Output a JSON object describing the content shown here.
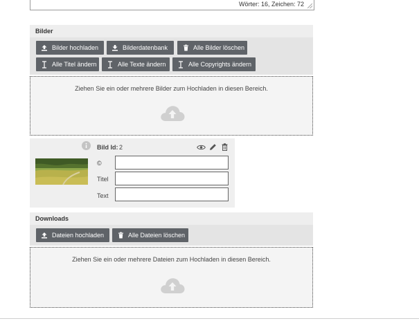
{
  "editor": {
    "wordcount": "Wörter: 16, Zeichen: 72"
  },
  "images": {
    "section_title": "Bilder",
    "buttons": {
      "upload": "Bilder hochladen",
      "database": "Bilderdatenbank",
      "delete_all": "Alle Bilder löschen",
      "edit_titles": "Alle Titel ändern",
      "edit_texts": "Alle Texte ändern",
      "edit_copyrights": "Alle Copyrights ändern"
    },
    "dropzone_text": "Ziehen Sie ein oder mehrere Bilder zum Hochladen in diesen Bereich.",
    "card": {
      "id_label": "Bild Id:",
      "id_value": "2",
      "copyright_label": "©",
      "title_label": "Titel",
      "text_label": "Text",
      "copyright_value": "",
      "title_value": "",
      "text_value": ""
    }
  },
  "downloads": {
    "section_title": "Downloads",
    "buttons": {
      "upload": "Dateien hochladen",
      "delete_all": "Alle Dateien löschen"
    },
    "dropzone_text": "Ziehen Sie ein oder mehrere Dateien zum Hochladen in diesen Bereich."
  },
  "icons": {
    "upload": "upload-icon",
    "download": "download-icon",
    "trash": "trash-icon",
    "text_cursor": "text-cursor-icon",
    "cloud_upload": "cloud-upload-icon",
    "info": "info-icon",
    "eye": "eye-icon",
    "pencil": "pencil-icon"
  },
  "colors": {
    "button_bg": "#5f6368",
    "section_bg": "#eeeeee",
    "dropzone_bg": "#f4f4f4"
  }
}
